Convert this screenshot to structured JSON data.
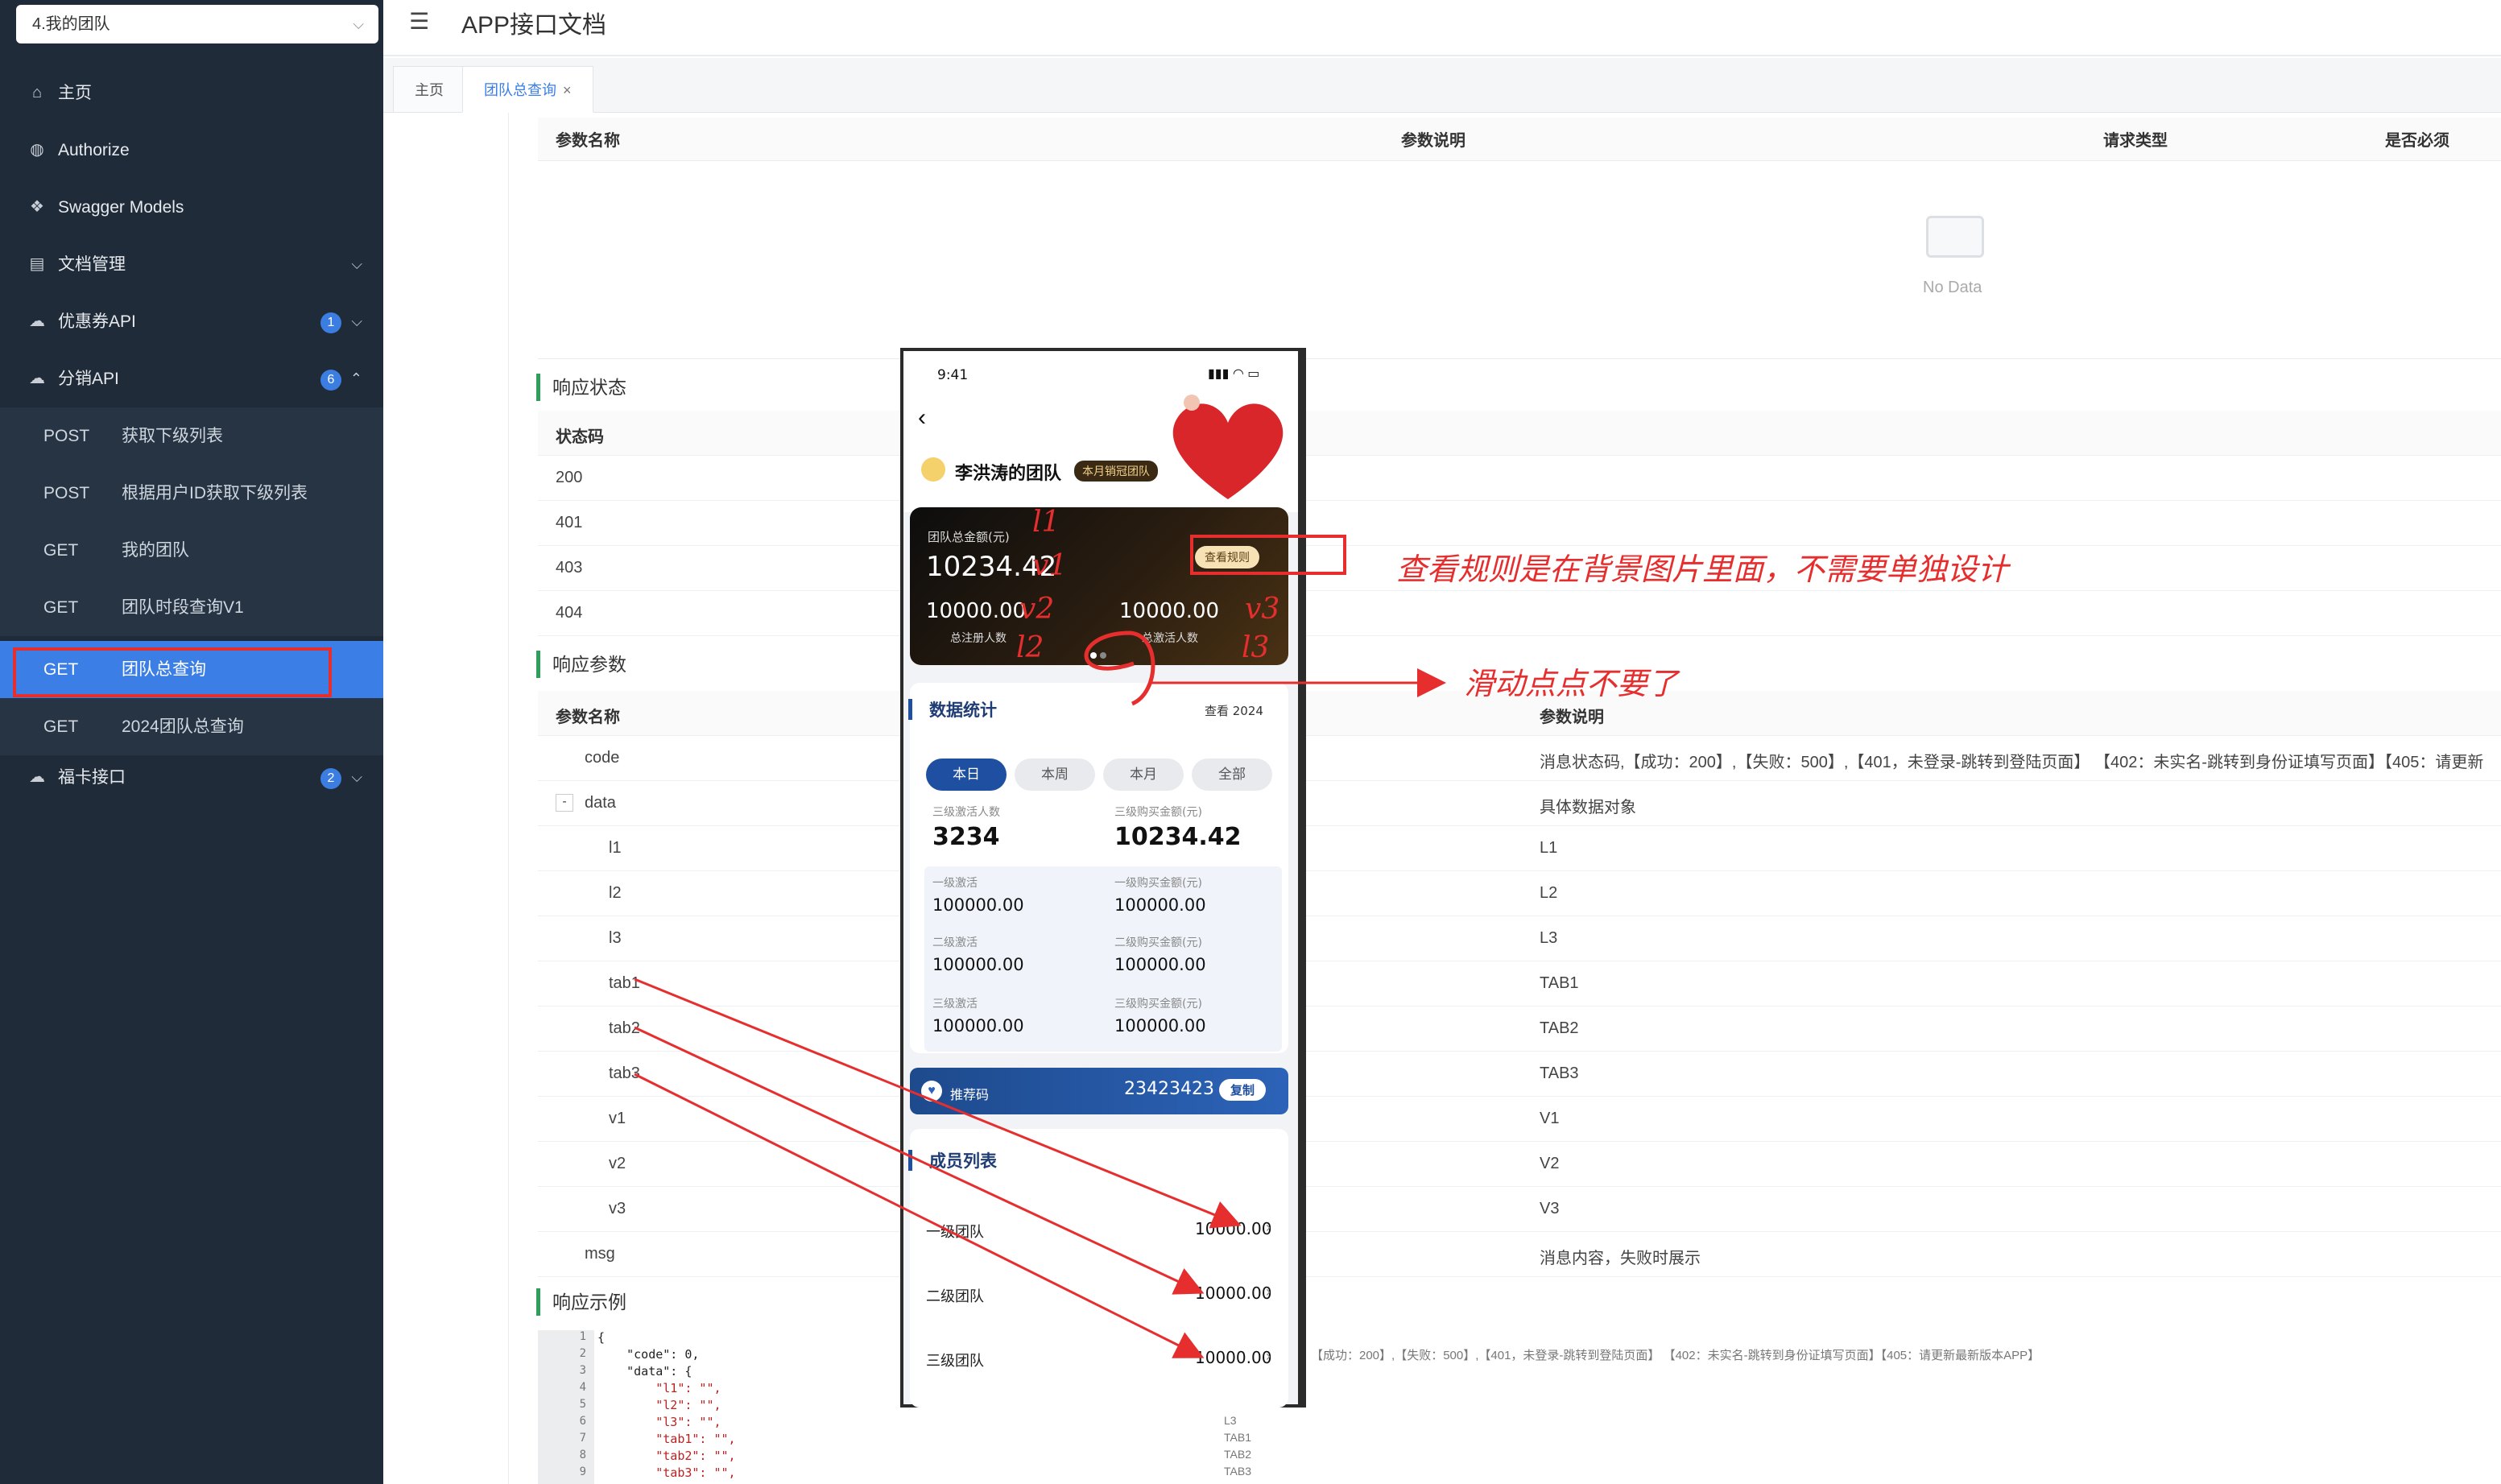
{
  "sidebar": {
    "team_select": "4.我的团队",
    "items": [
      {
        "label": "主页",
        "icon": "home-icon"
      },
      {
        "label": "Authorize",
        "icon": "lock-icon"
      },
      {
        "label": "Swagger Models",
        "icon": "cube-icon"
      },
      {
        "label": "文档管理",
        "icon": "doc-icon"
      },
      {
        "label": "优惠券API",
        "icon": "cloud-icon",
        "badge": "1"
      },
      {
        "label": "分销API",
        "icon": "cloud-icon",
        "badge": "6"
      }
    ],
    "sub_items": [
      {
        "method": "POST",
        "label": "获取下级列表"
      },
      {
        "method": "POST",
        "label": "根据用户ID获取下级列表"
      },
      {
        "method": "GET",
        "label": "我的团队"
      },
      {
        "method": "GET",
        "label": "团队时段查询V1"
      },
      {
        "method": "GET",
        "label": "团队总查询"
      },
      {
        "method": "GET",
        "label": "2024团队总查询"
      }
    ],
    "last_item": {
      "label": "福卡接口",
      "icon": "cloud-icon",
      "badge": "2"
    }
  },
  "header": {
    "title": "APP接口文档"
  },
  "tabs": [
    {
      "label": "主页"
    },
    {
      "label": "团队总查询"
    }
  ],
  "request_params": {
    "headers": [
      "参数名称",
      "参数说明",
      "请求类型",
      "是否必须"
    ],
    "empty_text": "No Data"
  },
  "response_status": {
    "title": "响应状态",
    "header": "状态码",
    "codes": [
      "200",
      "401",
      "403",
      "404"
    ]
  },
  "response_params": {
    "title": "响应参数",
    "headers": [
      "参数名称",
      "参数说明"
    ],
    "expand_toggle": "-",
    "rows": [
      {
        "name": "code",
        "desc": "消息状态码,【成功：200】,【失败：500】,【401，未登录-跳转到登陆页面】 【402：未实名-跳转到身份证填写页面】【405：请更新"
      },
      {
        "name": "data",
        "desc": "具体数据对象"
      },
      {
        "name": "l1",
        "desc": "L1"
      },
      {
        "name": "l2",
        "desc": "L2"
      },
      {
        "name": "l3",
        "desc": "L3"
      },
      {
        "name": "tab1",
        "desc": "TAB1"
      },
      {
        "name": "tab2",
        "desc": "TAB2"
      },
      {
        "name": "tab3",
        "desc": "TAB3"
      },
      {
        "name": "v1",
        "desc": "V1"
      },
      {
        "name": "v2",
        "desc": "V2"
      },
      {
        "name": "v3",
        "desc": "V3"
      },
      {
        "name": "msg",
        "desc": "消息内容，失败时展示"
      }
    ]
  },
  "response_example": {
    "title": "响应示例",
    "lines": [
      "1",
      "2",
      "3",
      "4",
      "5",
      "6",
      "7",
      "8",
      "9"
    ],
    "code": [
      "{",
      "    \"code\": 0,",
      "    \"data\": {",
      "        \"l1\": \"\",",
      "        \"l2\": \"\",",
      "        \"l3\": \"\",",
      "        \"tab1\": \"\",",
      "        \"tab2\": \"\",",
      "        \"tab3\": \"\","
    ],
    "side_desc": "【成功：200】,【失败：500】,【401，未登录-跳转到登陆页面】 【402：未实名-跳转到身份证填写页面】【405：请更新最新版本APP】",
    "side_vals": [
      "L3",
      "TAB1",
      "TAB2",
      "TAB3"
    ]
  },
  "phone": {
    "time": "9:41",
    "team_name": "李洪涛的团队",
    "team_badge": "本月销冠团队",
    "total_label": "团队总金额(元)",
    "total_value": "10234.42",
    "rules_btn": "查看规则",
    "v2_value": "10000.00",
    "v2_label": "总注册人数",
    "v3_value": "10000.00",
    "v3_label": "总激活人数",
    "stats_title": "数据统计",
    "stats_link": "查看 2024",
    "segments": [
      "本日",
      "本周",
      "本月",
      "全部"
    ],
    "big_stats": [
      {
        "label": "三级激活人数",
        "value": "3234"
      },
      {
        "label": "三级购买金额(元)",
        "value": "10234.42"
      }
    ],
    "grid": [
      {
        "label": "一级激活",
        "value": "100000.00"
      },
      {
        "label": "一级购买金额(元)",
        "value": "100000.00"
      },
      {
        "label": "二级激活",
        "value": "100000.00"
      },
      {
        "label": "二级购买金额(元)",
        "value": "100000.00"
      },
      {
        "label": "三级激活",
        "value": "100000.00"
      },
      {
        "label": "三级购买金额(元)",
        "value": "100000.00"
      }
    ],
    "ref_label": "推荐码",
    "ref_code": "23423423",
    "copy_btn": "复制",
    "members_title": "成员列表",
    "members": [
      {
        "label": "一级团队",
        "value": "10000.00"
      },
      {
        "label": "二级团队",
        "value": "10000.00"
      },
      {
        "label": "三级团队",
        "value": "10000.00"
      }
    ]
  },
  "annotations": {
    "rules_note": "查看规则是在背景图片里面，不需要单独设计",
    "dots_note": "滑动点点不要了",
    "marks": [
      "l1",
      "v1",
      "v2",
      "v3",
      "l2",
      "l3"
    ]
  },
  "colors": {
    "sidebar": "#1f2b38",
    "accent": "#3a7ee6",
    "annotation": "#e62e2e",
    "section": "#2e9e5b"
  }
}
